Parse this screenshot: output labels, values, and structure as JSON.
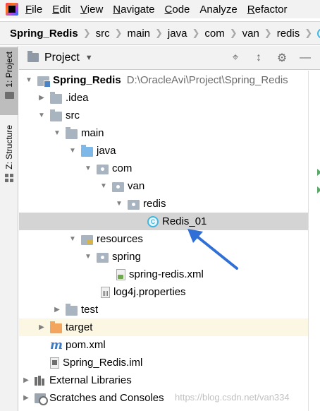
{
  "menu": {
    "items": [
      {
        "mnemonic": "F",
        "rest": "ile"
      },
      {
        "mnemonic": "E",
        "rest": "dit"
      },
      {
        "mnemonic": "V",
        "rest": "iew"
      },
      {
        "mnemonic": "N",
        "rest": "avigate"
      },
      {
        "mnemonic": "C",
        "rest": "ode"
      },
      {
        "mnemonic": "",
        "rest": "Analyze"
      },
      {
        "mnemonic": "R",
        "rest": "efactor"
      }
    ]
  },
  "breadcrumb": {
    "items": [
      "Spring_Redis",
      "src",
      "main",
      "java",
      "com",
      "van",
      "redis",
      "C"
    ]
  },
  "left_stripe": {
    "project_tab": "1: Project",
    "structure_tab": "Z: Structure"
  },
  "panel": {
    "title": "Project",
    "actions": [
      "crosshair-icon",
      "collapse-icon",
      "gear-icon",
      "minimize-icon"
    ]
  },
  "tree": {
    "rows": [
      {
        "label": "Spring_Redis",
        "path": "D:\\OracleAvi\\Project\\Spring_Redis",
        "icon": "module",
        "bold": true
      },
      {
        "label": ".idea",
        "icon": "folder"
      },
      {
        "label": "src",
        "icon": "folder"
      },
      {
        "label": "main",
        "icon": "folder"
      },
      {
        "label": "java",
        "icon": "source-folder"
      },
      {
        "label": "com",
        "icon": "package"
      },
      {
        "label": "van",
        "icon": "package"
      },
      {
        "label": "redis",
        "icon": "package"
      },
      {
        "label": "Redis_01",
        "icon": "class"
      },
      {
        "label": "resources",
        "icon": "resources-folder"
      },
      {
        "label": "spring",
        "icon": "package"
      },
      {
        "label": "spring-redis.xml",
        "icon": "xml-file"
      },
      {
        "label": "log4j.properties",
        "icon": "properties-file"
      },
      {
        "label": "test",
        "icon": "folder"
      },
      {
        "label": "target",
        "icon": "excluded-folder"
      },
      {
        "label": "pom.xml",
        "icon": "maven-file"
      },
      {
        "label": "Spring_Redis.iml",
        "icon": "iml-file"
      },
      {
        "label": "External Libraries",
        "icon": "libraries"
      },
      {
        "label": "Scratches and Consoles",
        "icon": "scratches"
      }
    ]
  },
  "watermark": "https://blog.csdn.net/van334",
  "colors": {
    "selection": "#d4d4d4",
    "excluded_row": "#fcf7e3",
    "annotation_arrow": "#2f6fd6"
  }
}
